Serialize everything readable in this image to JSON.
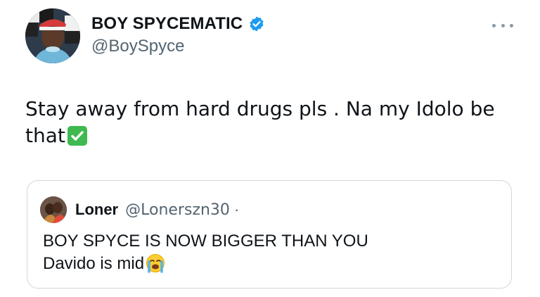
{
  "tweet": {
    "author": {
      "name": "BOY SPYCEMATIC",
      "handle": "@BoySpyce",
      "verified": true,
      "avatar_icon": "profile-photo"
    },
    "more_icon": "ellipsis-icon",
    "text_line1": "Stay away from hard drugs pls . Na my Idolo be",
    "text_line2": "that",
    "text_emoji": "check-mark-button-icon",
    "colors": {
      "text": "#0f1419",
      "secondary": "#536471",
      "verified": "#1d9bf0",
      "check_emoji": "#3fb950",
      "border": "#cfd9de"
    }
  },
  "quote": {
    "author": {
      "name": "Loner",
      "handle": "@Lonerszn30",
      "separator": "·",
      "avatar_icon": "profile-photo"
    },
    "line1": "BOY SPYCE IS NOW BIGGER THAN YOU",
    "line2": "Davido is mid",
    "emoji": "loudly-crying-face-icon"
  }
}
